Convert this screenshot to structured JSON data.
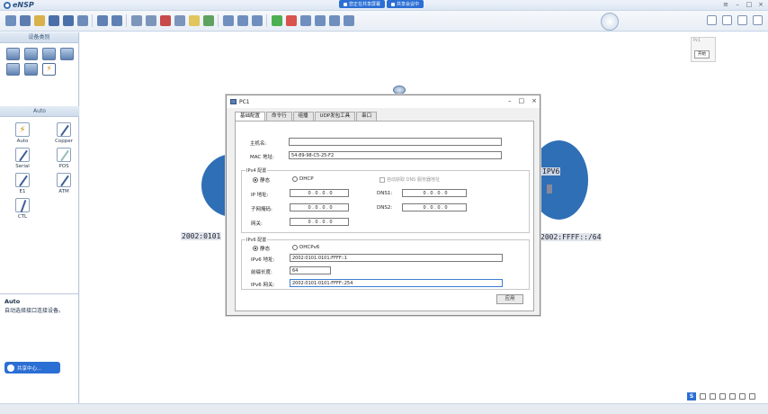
{
  "app": {
    "title": "eNSP"
  },
  "share_bar": {
    "pill1": "您正在共享屏幕",
    "pill2": "共享会议中"
  },
  "left_panel": {
    "header": "设备类别",
    "section2_header": "Auto",
    "cables": [
      {
        "label": "Auto"
      },
      {
        "label": "Copper"
      },
      {
        "label": "Serial"
      },
      {
        "label": "POS"
      },
      {
        "label": "E1"
      },
      {
        "label": "ATM"
      },
      {
        "label": "CTL"
      }
    ],
    "desc_title": "Auto",
    "desc_text": "自动选择接口连接设备。",
    "share_button": "共享中心..."
  },
  "canvas": {
    "tip_title": "Pc1",
    "tip_button": "开始",
    "label_left": "2002:0101",
    "label_right": "2002:FFFF::/64",
    "label_ipv6": "IPV6"
  },
  "dialog": {
    "title": "PC1",
    "tabs": [
      "基础配置",
      "命令行",
      "组播",
      "UDP发包工具",
      "串口"
    ],
    "hostname_label": "主机名:",
    "hostname_value": "",
    "mac_label": "MAC 地址:",
    "mac_value": "54-89-98-C5-25-F2",
    "ipv4": {
      "group_title": "IPv4 配置",
      "static_label": "静态",
      "dhcp_label": "DHCP",
      "auto_dns_label": "自动获取 DNS 服务器地址",
      "ip_label": "IP 地址:",
      "ip_value": "0 . 0 . 0 . 0",
      "mask_label": "子网掩码:",
      "mask_value": "0 . 0 . 0 . 0",
      "gateway_label": "网关:",
      "gateway_value": "0 . 0 . 0 . 0",
      "dns1_label": "DNS1:",
      "dns1_value": "0 . 0 . 0 . 0",
      "dns2_label": "DNS2:",
      "dns2_value": "0 . 0 . 0 . 0"
    },
    "ipv6": {
      "group_title": "IPv6 配置",
      "static_label": "静态",
      "dhcp_label": "DHCPv6",
      "ip_label": "IPv6 地址:",
      "ip_value": "2002:0101:0101:FFFF::1",
      "prefix_label": "前缀长度:",
      "prefix_value": "64",
      "gateway_label": "IPv6 网关:",
      "gateway_value": "2002:0101:0101:FFFF::254"
    },
    "apply_button": "应用"
  }
}
